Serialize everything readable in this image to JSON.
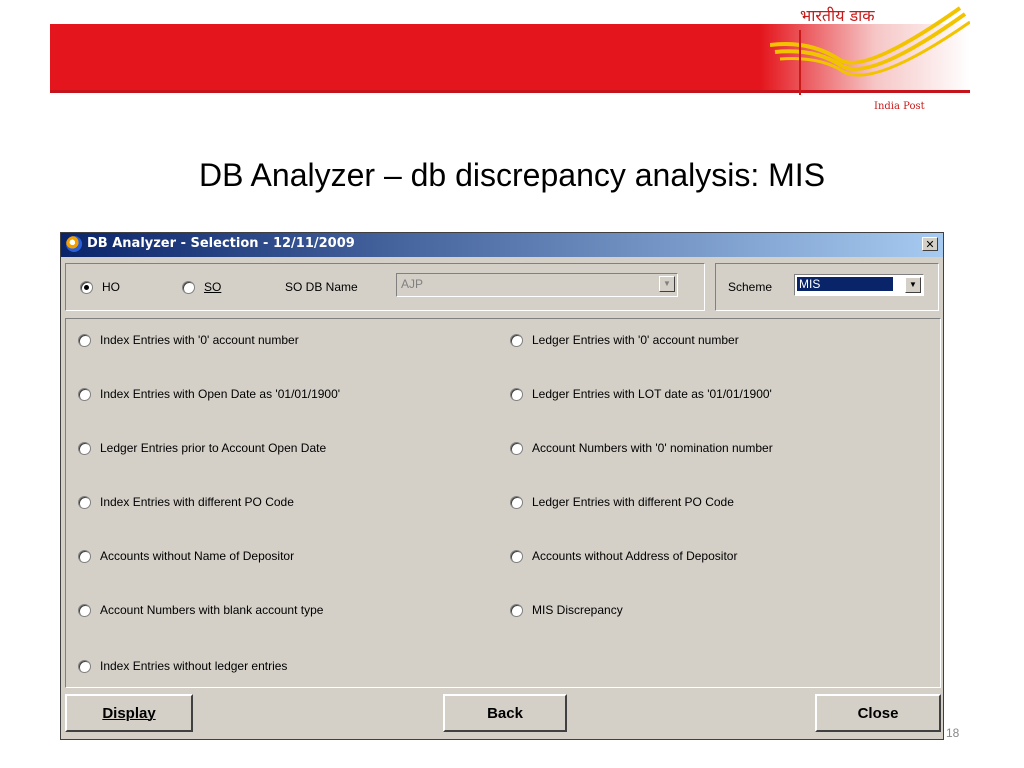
{
  "logo": {
    "hindi": "भारतीय डाक",
    "english": "India Post"
  },
  "slide": {
    "title": "DB Analyzer – db discrepancy analysis: MIS",
    "page_number": "18"
  },
  "window": {
    "title": "DB Analyzer - Selection - 12/11/2009",
    "close_glyph": "✕",
    "colors": {
      "titlebar_start": "#0a246a",
      "titlebar_end": "#a6caf0",
      "face": "#d4d0c8"
    }
  },
  "top": {
    "ho_label": "HO",
    "so_label": "SO",
    "so_db_name_label": "SO DB Name",
    "so_db_name_value": "AJP",
    "scheme_label": "Scheme",
    "scheme_value": "MIS",
    "selected_office": "HO"
  },
  "options_left": [
    "Index Entries with '0' account number",
    "Index Entries with Open Date as '01/01/1900'",
    "Ledger Entries prior to Account Open Date",
    "Index Entries with different PO Code",
    "Accounts without Name of Depositor",
    "Account Numbers with blank account type",
    "Index Entries without ledger entries"
  ],
  "options_right": [
    "Ledger Entries with '0' account number",
    "Ledger Entries with LOT date as '01/01/1900'",
    "Account Numbers with '0' nomination number",
    "Ledger Entries with different PO Code",
    "Accounts without Address of Depositor",
    "MIS Discrepancy"
  ],
  "buttons": {
    "display": "Display",
    "back": "Back",
    "close": "Close"
  },
  "icons": {
    "title_icon": "app-icon",
    "dropdown": "chevron-down-icon",
    "close": "close-icon"
  }
}
